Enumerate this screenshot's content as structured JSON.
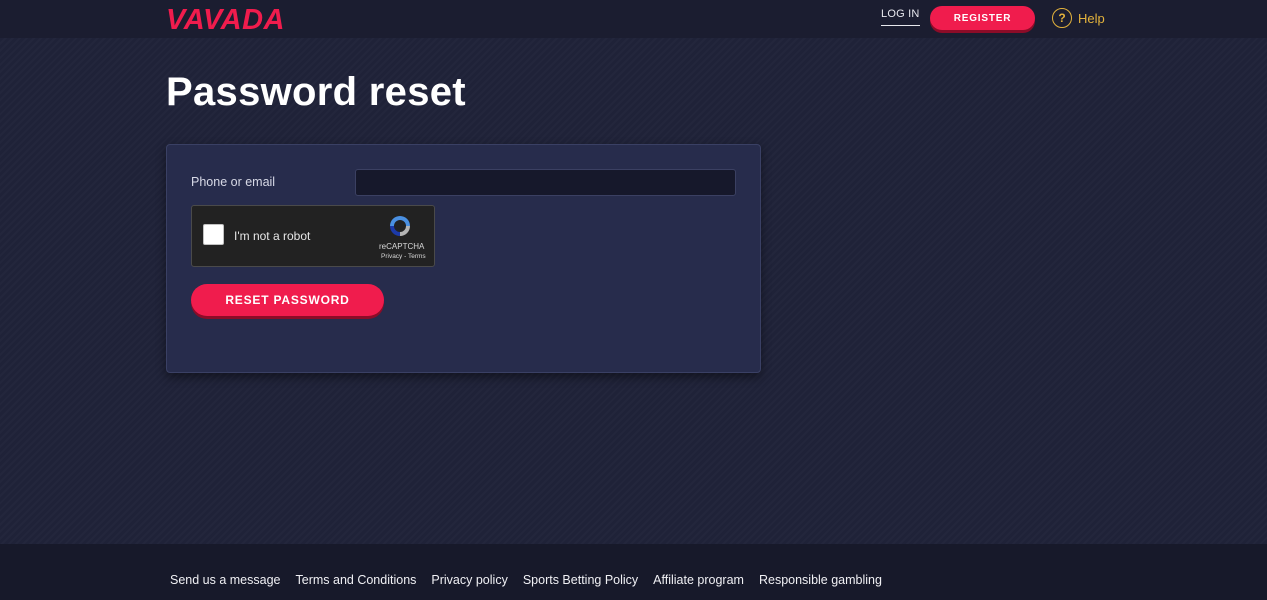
{
  "header": {
    "logo_text": "VAVADA",
    "login_label": "LOG IN",
    "register_label": "REGISTER",
    "help_label": "Help",
    "help_icon": "question-circle-icon"
  },
  "main": {
    "title": "Password reset",
    "form": {
      "field_label": "Phone or email",
      "field_value": "",
      "field_placeholder": "",
      "recaptcha": {
        "label": "I'm not a robot",
        "brand": "reCAPTCHA",
        "links": "Privacy - Terms"
      },
      "submit_label": "RESET PASSWORD"
    }
  },
  "footer": {
    "links": [
      "Send us a message",
      "Terms and Conditions",
      "Privacy policy",
      "Sports Betting Policy",
      "Affiliate program",
      "Responsible gambling"
    ]
  },
  "colors": {
    "accent": "#f01c4d",
    "help": "#e3b23c",
    "background": "#1f2238",
    "card": "#272c4c"
  }
}
